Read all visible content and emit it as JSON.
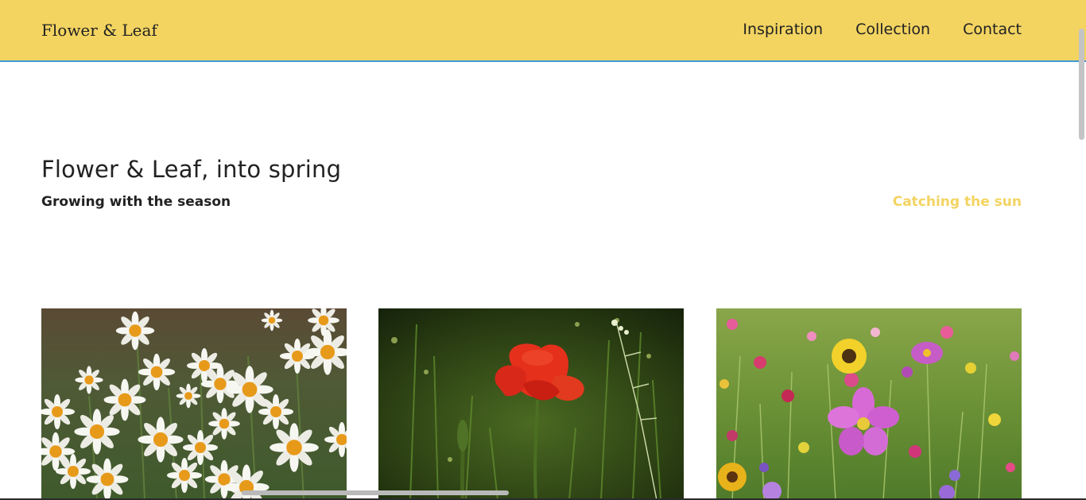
{
  "header": {
    "brand": "Flower & Leaf",
    "nav": [
      "Inspiration",
      "Collection",
      "Contact"
    ],
    "background_color": "#f3d461",
    "border_color": "#3d9bd4"
  },
  "hero": {
    "title": "Flower & Leaf, into spring",
    "subtitle": "Growing with the season",
    "link": "Catching the sun",
    "link_color": "#f3d461"
  },
  "gallery": {
    "photos": [
      {
        "subject": "white-daisies"
      },
      {
        "subject": "red-poppy"
      },
      {
        "subject": "wildflower-meadow"
      }
    ]
  }
}
